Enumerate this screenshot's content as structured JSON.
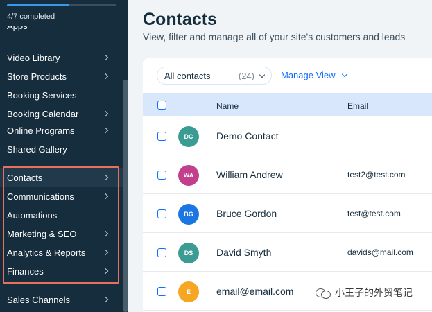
{
  "sidebar": {
    "progress": {
      "label": "4/7 completed",
      "fraction": 0.57
    },
    "items": [
      {
        "label": "Video Library",
        "chevron": true,
        "active": false
      },
      {
        "label": "Store Products",
        "chevron": true,
        "active": false
      },
      {
        "label": "Booking Services",
        "chevron": false,
        "active": false
      },
      {
        "label": "Booking Calendar",
        "chevron": true,
        "active": false
      },
      {
        "label": "Online Programs",
        "chevron": true,
        "active": false
      },
      {
        "label": "Shared Gallery",
        "chevron": false,
        "active": false
      },
      {
        "label": "Contacts",
        "chevron": true,
        "active": true
      },
      {
        "label": "Communications",
        "chevron": true,
        "active": false
      },
      {
        "label": "Automations",
        "chevron": false,
        "active": false
      },
      {
        "label": "Marketing & SEO",
        "chevron": true,
        "active": false
      },
      {
        "label": "Analytics & Reports",
        "chevron": true,
        "active": false
      },
      {
        "label": "Finances",
        "chevron": true,
        "active": false
      },
      {
        "label": "Sales Channels",
        "chevron": true,
        "active": false
      }
    ]
  },
  "header": {
    "title": "Contacts",
    "subtitle": "View, filter and manage all of your site's customers and leads"
  },
  "toolbar": {
    "filter_label": "All contacts",
    "filter_count": "(24)",
    "manage_view": "Manage View"
  },
  "table": {
    "columns": [
      "Name",
      "Email"
    ],
    "rows": [
      {
        "initials": "DC",
        "name": "Demo Contact",
        "email": "",
        "color": "#3b9c94"
      },
      {
        "initials": "WA",
        "name": "William Andrew",
        "email": "test2@test.com",
        "color": "#c23f8e"
      },
      {
        "initials": "BG",
        "name": "Bruce Gordon",
        "email": "test@test.com",
        "color": "#1b75e2"
      },
      {
        "initials": "DS",
        "name": "David Smyth",
        "email": "davids@mail.com",
        "color": "#3b9c94"
      },
      {
        "initials": "E",
        "name": "email@email.com",
        "email": "",
        "color": "#f5a623"
      }
    ]
  },
  "watermark": {
    "text": "小王子的外贸笔记"
  }
}
